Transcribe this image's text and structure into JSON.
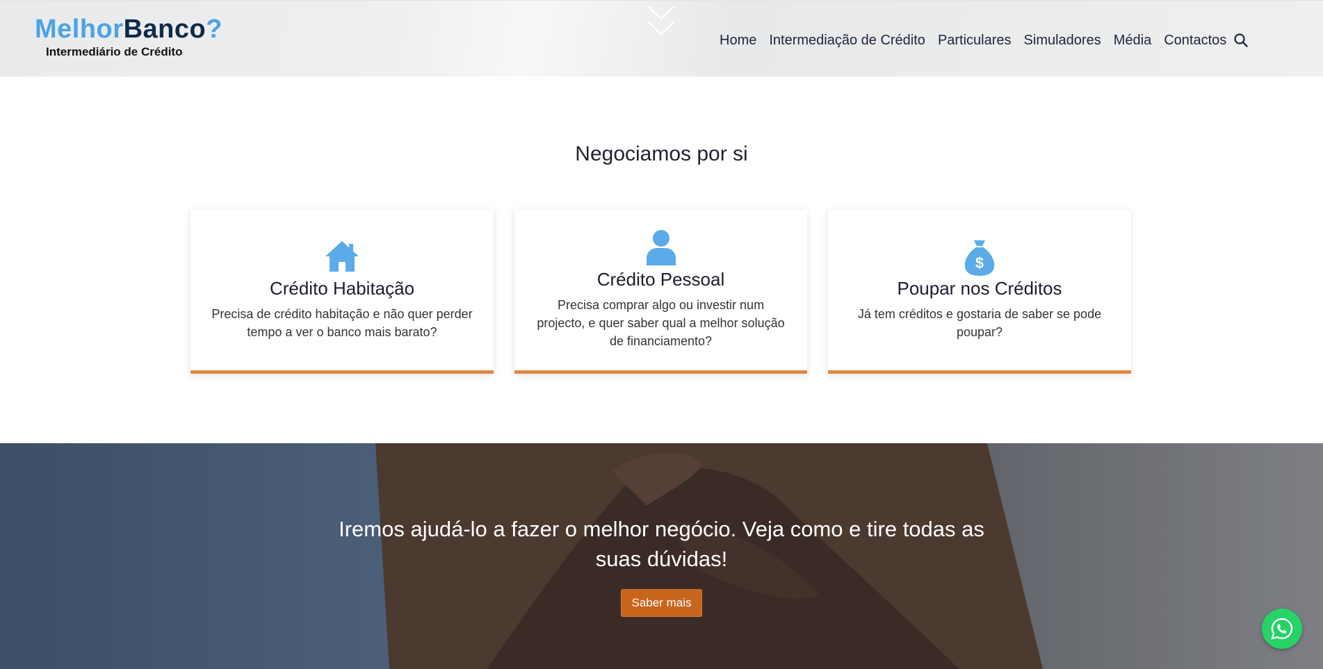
{
  "brand": {
    "part1": "Melhor",
    "part2": "Banco",
    "part3": "?",
    "subtitle": "Intermediário de Crédito",
    "colors": {
      "light_blue": "#4aa3e3",
      "navy": "#0f2a4a"
    }
  },
  "nav": {
    "items": [
      {
        "label": "Home"
      },
      {
        "label": "Intermediação de Crédito"
      },
      {
        "label": "Particulares"
      },
      {
        "label": "Simuladores"
      },
      {
        "label": "Média"
      },
      {
        "label": "Contactos"
      }
    ],
    "search_icon": "search-icon"
  },
  "section": {
    "title": "Negociamos por si"
  },
  "cards": [
    {
      "icon": "house-icon",
      "title": "Crédito Habitação",
      "text": "Precisa de crédito habitação e não quer perder tempo a ver o banco mais barato?"
    },
    {
      "icon": "person-icon",
      "title": "Crédito Pessoal",
      "text": "Precisa comprar algo ou investir num projecto, e quer saber qual a melhor solução de financiamento?"
    },
    {
      "icon": "money-bag-icon",
      "title": "Poupar nos Créditos",
      "text": "Já tem créditos e gostaria de saber se pode poupar?"
    }
  ],
  "hero": {
    "text": "Iremos ajudá-lo a fazer o melhor negócio. Veja como e tire todas as suas dúvidas!",
    "button": "Saber mais"
  },
  "colors": {
    "accent": "#e08a45",
    "icon_blue": "#5aabe8",
    "button": "#c8651d",
    "whatsapp": "#25d366"
  }
}
